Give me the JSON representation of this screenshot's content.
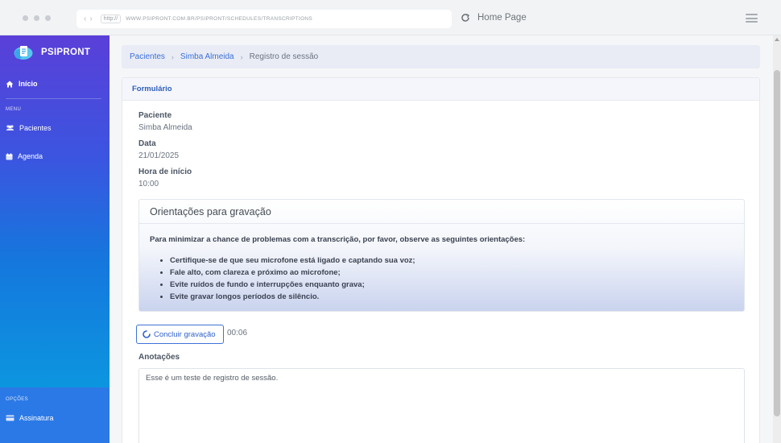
{
  "browser": {
    "protocol": "http://",
    "url": "WWW.PSIPRONT.COM.BR/PSIPRONT/SCHEDULES/TRANSCRIPTIONS",
    "home_label": "Home Page"
  },
  "sidebar": {
    "brand": "PSIPRONT",
    "home_item": "Início",
    "menu_section": "MENU",
    "items": [
      {
        "label": "Pacientes",
        "icon": "users-icon"
      },
      {
        "label": "Agenda",
        "icon": "calendar-icon"
      }
    ],
    "options_section": "OPÇÕES",
    "subscription_item": "Assinatura"
  },
  "breadcrumb": {
    "items": [
      "Pacientes",
      "Simba Almeida"
    ],
    "current": "Registro de sessão"
  },
  "form": {
    "title": "Formulário",
    "patient_label": "Paciente",
    "patient_value": "Simba Almeida",
    "date_label": "Data",
    "date_value": "21/01/2025",
    "start_label": "Hora de início",
    "start_value": "10:00"
  },
  "guidelines": {
    "title": "Orientações para gravação",
    "intro": "Para minimizar a chance de problemas com a transcrição, por favor, observe as seguintes orientações:",
    "items": [
      "Certifique-se de que seu microfone está ligado e captando sua voz;",
      "Fale alto, com clareza e próximo ao microfone;",
      "Evite ruídos de fundo e interrupções enquanto grava;",
      "Evite gravar longos períodos de silêncio."
    ]
  },
  "recording": {
    "button_label": "Concluir gravação",
    "elapsed": "00:06"
  },
  "notes": {
    "label": "Anotações",
    "value": "Esse é um teste de registro de sessão."
  },
  "colors": {
    "accent": "#3d72d9",
    "sidebar_top": "#5a3fd8",
    "sidebar_bottom": "#08a3e0"
  }
}
